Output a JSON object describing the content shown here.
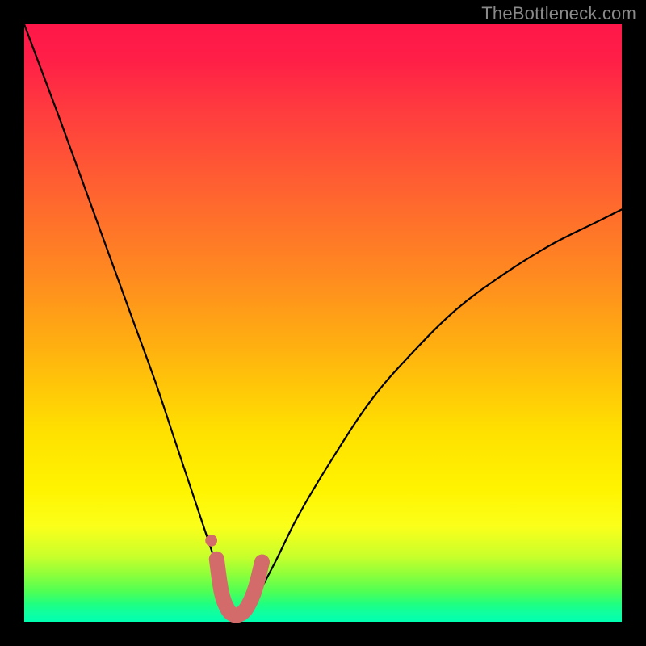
{
  "watermark": "TheBottleneck.com",
  "chart_data": {
    "type": "line",
    "title": "",
    "xlabel": "",
    "ylabel": "",
    "xlim": [
      0,
      100
    ],
    "ylim": [
      0,
      100
    ],
    "grid": false,
    "legend": false,
    "background_gradient": {
      "direction": "vertical",
      "stops": [
        {
          "pos": 0.0,
          "color": "#ff1749"
        },
        {
          "pos": 0.28,
          "color": "#ff6330"
        },
        {
          "pos": 0.54,
          "color": "#ffb010"
        },
        {
          "pos": 0.78,
          "color": "#fff400"
        },
        {
          "pos": 0.92,
          "color": "#8fff3a"
        },
        {
          "pos": 1.0,
          "color": "#00ffb0"
        }
      ]
    },
    "series": [
      {
        "name": "bottleneck-curve",
        "color": "#000000",
        "x": [
          0,
          3,
          6,
          10,
          14,
          18,
          22,
          25,
          28,
          30,
          32,
          33.5,
          35,
          36,
          37,
          38,
          42,
          46,
          52,
          58,
          64,
          72,
          80,
          88,
          96,
          100
        ],
        "y": [
          100,
          92,
          84,
          73,
          62,
          51,
          40,
          31,
          22,
          16,
          10,
          5.5,
          2.5,
          1.2,
          1.2,
          2.5,
          10,
          18,
          28,
          37,
          44,
          52,
          58,
          63,
          67,
          69
        ]
      }
    ],
    "minimum_marker": {
      "color": "#d36b6b",
      "path_x": [
        32.2,
        33.0,
        34.0,
        35.0,
        36.0,
        37.0,
        38.0,
        38.8,
        39.8
      ],
      "path_y": [
        10.5,
        5.0,
        2.2,
        1.2,
        1.2,
        2.0,
        3.8,
        6.0,
        10.0
      ],
      "dot": {
        "x": 31.3,
        "y": 13.6,
        "r": 1.0
      }
    }
  }
}
